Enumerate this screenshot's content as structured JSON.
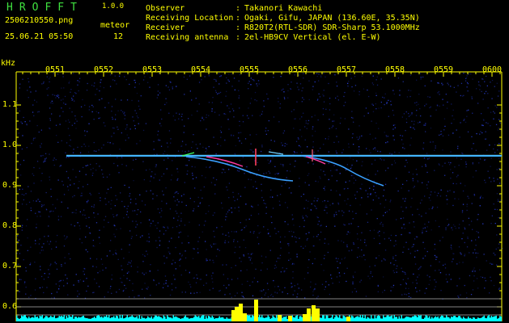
{
  "header": {
    "app_name": "HROFFT",
    "app_version": "1.0.0",
    "filename": "2506210550.png",
    "datetime": "25.06.21 05:50",
    "meteor_label": "meteor",
    "meteor_count": "12"
  },
  "info": [
    {
      "key": "Observer",
      "value": "Takanori Kawachi"
    },
    {
      "key": "Receiving Location",
      "value": "Ogaki, Gifu, JAPAN (136.60E, 35.35N)"
    },
    {
      "key": "Receiver",
      "value": "R820T2(RTL-SDR) SDR-Sharp 53.1000MHz"
    },
    {
      "key": "Receiving antenna",
      "value": "2el-HB9CV Vertical (el. E-W)"
    }
  ],
  "separator": ":",
  "plot": {
    "unit_label": "kHz",
    "time_labels": [
      "0551",
      "0552",
      "0553",
      "0554",
      "0555",
      "0556",
      "0557",
      "0558",
      "0559",
      "0600"
    ],
    "freq_labels": [
      "1.1",
      "1.0",
      "0.9",
      "0.8",
      "0.7",
      "0.6"
    ],
    "colors": {
      "axis": "#ffff00",
      "carrier": "#3ab0ff",
      "noise": "#1c2aa0",
      "level": "#00ffff",
      "peak": "#ffff00"
    }
  }
}
